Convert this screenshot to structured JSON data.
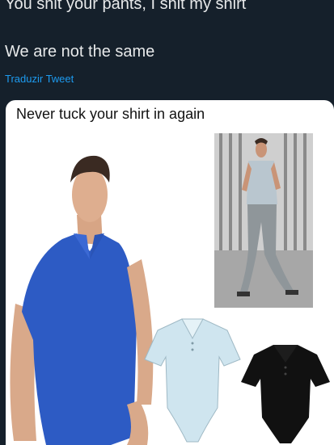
{
  "tweet": {
    "line1": "You shit your pants, I shit my shirt",
    "line2": "We are not the same",
    "translate_link": "Traduzir Tweet"
  },
  "media": {
    "caption": "Never tuck your shirt in again",
    "colors": {
      "blue_bodysuit": "#2d5bc4",
      "light_blue_bodysuit": "#cfe5ef",
      "black_bodysuit": "#111111",
      "grey_polo": "#b9c6cf",
      "grey_jeans": "#8f969a"
    }
  }
}
